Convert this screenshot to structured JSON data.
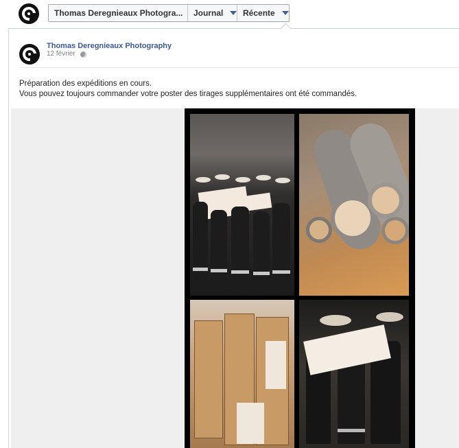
{
  "header": {
    "tabs": [
      {
        "label": "Thomas Deregnieaux Photogra...",
        "has_caret": false
      },
      {
        "label": "Journal",
        "has_caret": true
      },
      {
        "label": "Récente",
        "has_caret": true
      }
    ]
  },
  "post": {
    "author": "Thomas Deregnieaux Photography",
    "date": "12 février",
    "privacy_icon": "globe-icon",
    "message": [
      "Préparation des expéditions en cours.",
      "Vous pouvez toujours commander votre poster des tirages supplémentaires ont été commandés."
    ]
  },
  "photo": {
    "tiles": 4
  },
  "colors": {
    "link": "#3b5998",
    "caret": "#4b5f8c",
    "frame": "#c9cdd6"
  }
}
